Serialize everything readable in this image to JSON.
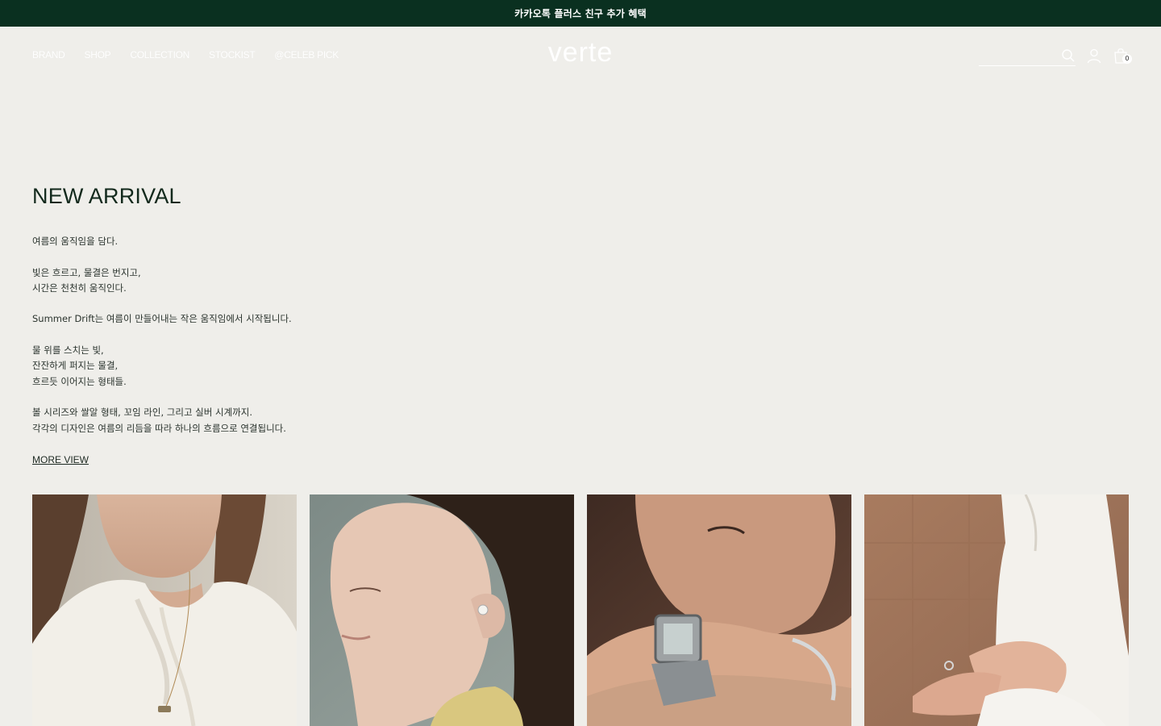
{
  "announcement": {
    "text": "카카오톡 플러스 친구 추가 혜택"
  },
  "nav": {
    "items": [
      {
        "label": "BRAND"
      },
      {
        "label": "SHOP"
      },
      {
        "label": "COLLECTION"
      },
      {
        "label": "STOCKIST"
      },
      {
        "label": "@CELEB PICK"
      }
    ]
  },
  "brand": {
    "logo": "verte"
  },
  "search": {
    "placeholder": ""
  },
  "cart": {
    "count": "0"
  },
  "section": {
    "title": "NEW ARRIVAL",
    "lines": [
      "여름의 움직임을 담다.",
      "",
      "빛은 흐르고, 물결은 번지고,",
      "시간은 천천히 움직인다.",
      "",
      "Summer Drift는 여름이 만들어내는 작은 움직임에서 시작됩니다.",
      "",
      "물 위를 스치는 빛,",
      "잔잔하게 퍼지는 물결,",
      "흐르듯 이어지는 형태들.",
      "",
      "볼 시리즈와 쌀알 형태, 꼬임 라인, 그리고 실버 시계까지.",
      "각각의 디자인은 여름의 리듬을 따라 하나의 흐름으로 연결됩니다."
    ],
    "more_label": "MORE VIEW"
  },
  "colors": {
    "topbar_bg": "#0a3020",
    "page_bg": "#efeeea",
    "heading": "#12291c"
  },
  "products": [
    {
      "image": "woman-white-blouse-necklace"
    },
    {
      "image": "woman-profile-pearl-earring"
    },
    {
      "image": "woman-silver-watch-bangle"
    },
    {
      "image": "hands-silver-ring-white-dress"
    }
  ]
}
